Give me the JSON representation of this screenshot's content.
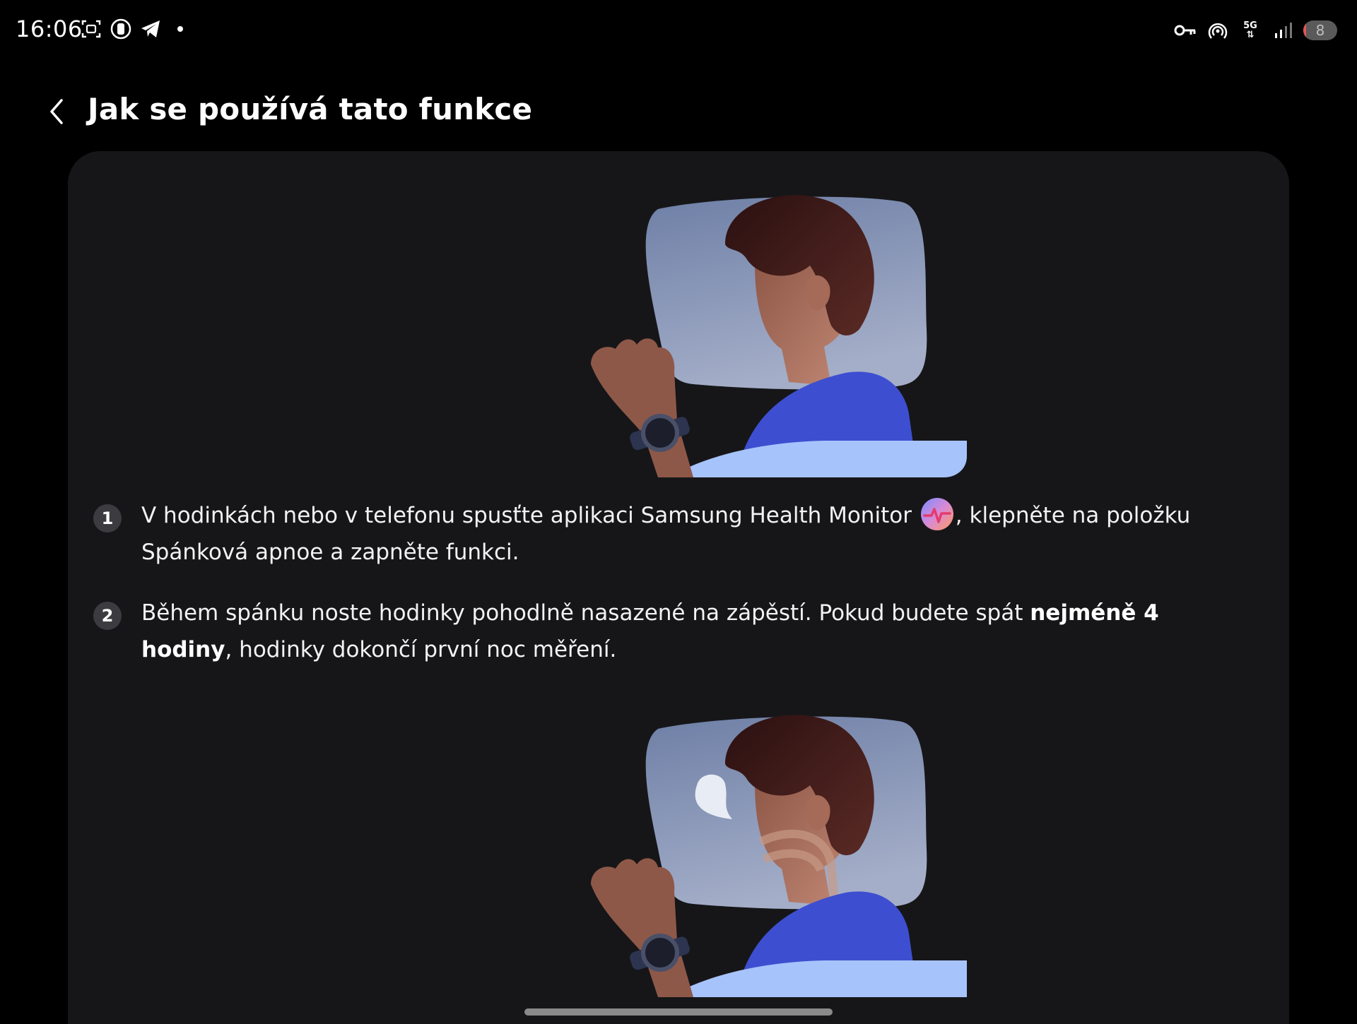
{
  "status_bar": {
    "time": "16:06",
    "left_icons": [
      "screenshot-icon",
      "watch-icon",
      "telegram-icon",
      "notification-dot-icon"
    ],
    "right_icons": [
      "key-icon",
      "hotspot-icon",
      "network-5g-icon",
      "signal-icon"
    ],
    "network_label": "5G",
    "battery_level": "8",
    "battery_fraction": 0.08
  },
  "header": {
    "back_icon": "chevron-left-icon",
    "title": "Jak se používá tato funkce"
  },
  "steps": [
    {
      "number": "1",
      "text_before": "V hodinkách nebo v telefonu spusťte aplikaci Samsung Health Monitor ",
      "app_icon": "samsung-health-monitor-icon",
      "text_after": ", klepněte na položku Spánková apnoe a zapněte funkci."
    },
    {
      "number": "2",
      "text_before": "Během spánku noste hodinky pohodlně nasazené na zápěstí. Pokud budete spát ",
      "text_bold": "nejméně 4 hodiny",
      "text_after": ", hodinky dokončí první noc měření."
    }
  ],
  "colors": {
    "background": "#000000",
    "card": "#161619",
    "blanket_dark": "#3d4fd0",
    "blanket_light": "#a7c3fb",
    "pillow": "#8d97b8",
    "hair": "#3a1a1a",
    "skin": "#a46d5a"
  }
}
